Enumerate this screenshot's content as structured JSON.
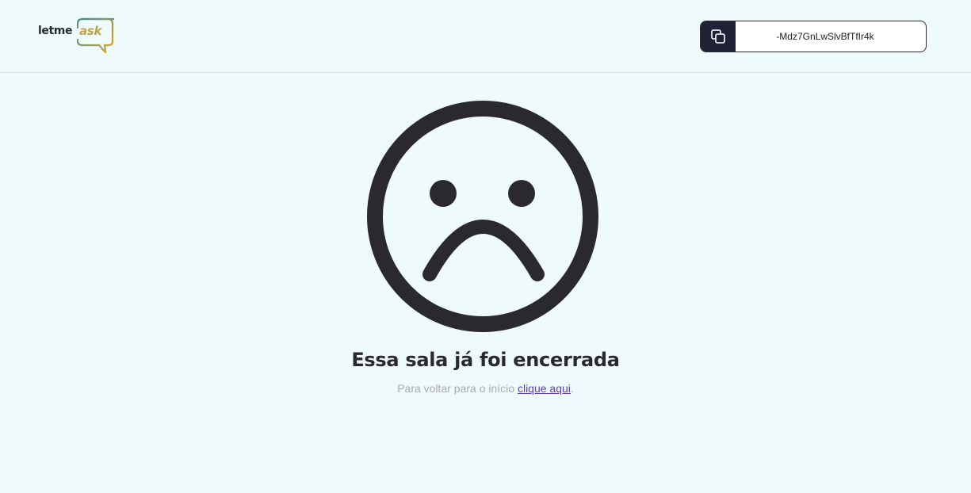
{
  "header": {
    "logo": {
      "text_left": "letme",
      "text_right": "ask",
      "icon": "speech-bubble-icon"
    },
    "room_code": {
      "icon": "copy-icon",
      "code": "-Mdz7GnLwSlvBfTfIr4k"
    }
  },
  "main": {
    "illustration": "sad-face-icon",
    "title": "Essa sala já foi encerrada",
    "subtitle_prefix": "Para voltar para o início ",
    "link_label": "clique aqui",
    "subtitle_suffix": "."
  },
  "colors": {
    "background": "#effbfa",
    "text": "#29292e",
    "muted": "#a8a8b3",
    "link": "#5b3ea7",
    "copy_button": "#1f2335",
    "logo_accent": "#b9a64a"
  }
}
